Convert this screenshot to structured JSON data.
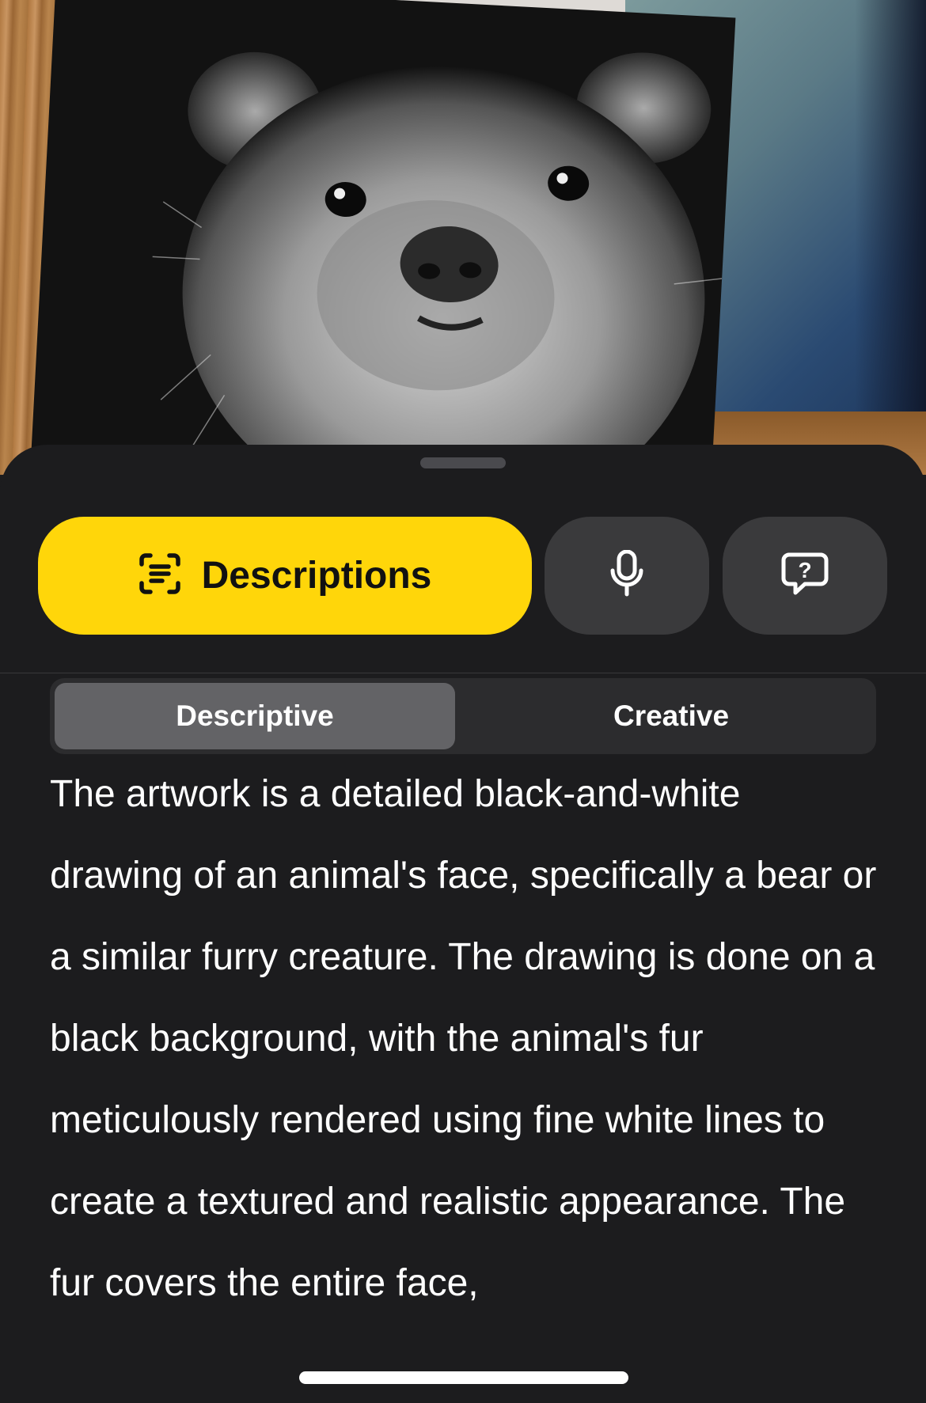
{
  "camera": {
    "subject": "animal-drawing-photo"
  },
  "sheet": {
    "modes": {
      "descriptions_label": "Descriptions",
      "descriptions_icon": "text-scan-icon",
      "microphone_icon": "microphone-icon",
      "question_icon": "question-bubble-icon",
      "active_color": "#ffd60a"
    },
    "segmented": {
      "options": [
        "Descriptive",
        "Creative"
      ],
      "selected": "Descriptive"
    },
    "description": "The artwork is a detailed black-and-white drawing of an animal's face, specifically a bear or a similar furry creature. The drawing is done on a black background, with the animal's fur meticulously rendered using fine white lines to create a textured and realistic appearance. The fur covers the entire face,"
  }
}
